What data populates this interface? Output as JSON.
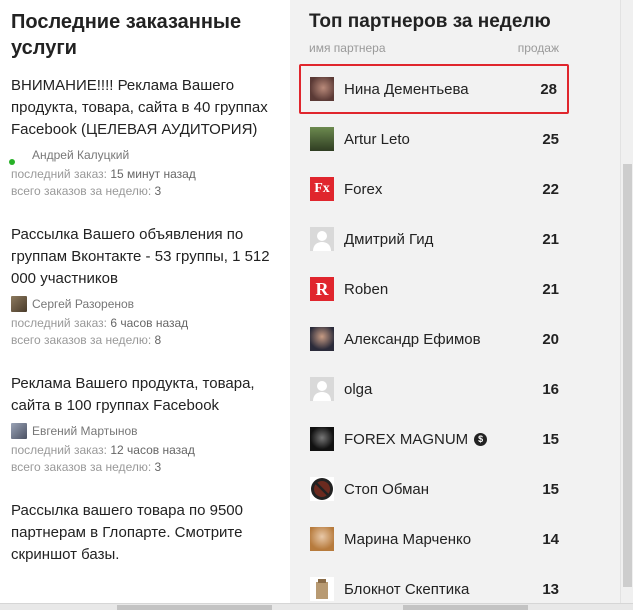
{
  "left": {
    "title": "Последние заказанные услуги",
    "orders": [
      {
        "title": "ВНИМАНИЕ!!!! Реклама Вашего продукта, товара, сайта в 40 группах Facebook (ЦЕЛЕВАЯ АУДИТОРИЯ)",
        "user": "Андрей Калуцкий",
        "last_label": "последний заказ:",
        "last_value": "15 минут назад",
        "week_label": "всего заказов за неделю:",
        "week_value": "3"
      },
      {
        "title": "Рассылка Вашего объявления по группам Вконтакте - 53 группы, 1 512 000 участников",
        "user": "Сергей Разоренов",
        "last_label": "последний заказ:",
        "last_value": "6 часов назад",
        "week_label": "всего заказов за неделю:",
        "week_value": "8"
      },
      {
        "title": "Реклама Вашего продукта, товара, сайта в 100 группах Facebook",
        "user": "Евгений Мартынов",
        "last_label": "последний заказ:",
        "last_value": "12 часов назад",
        "week_label": "всего заказов за неделю:",
        "week_value": "3"
      },
      {
        "title": "Рассылка вашего товара по 9500 партнерам в Глопарте. Смотрите скриншот базы."
      }
    ]
  },
  "right": {
    "title": "Топ партнеров за неделю",
    "col_name": "имя партнера",
    "col_sales": "продаж",
    "partners": [
      {
        "name": "Нина Дементьева",
        "sales": "28",
        "highlight": true
      },
      {
        "name": "Artur Leto",
        "sales": "25"
      },
      {
        "name": "Forex",
        "sales": "22",
        "avatar_text": "Fx"
      },
      {
        "name": "Дмитрий Гид",
        "sales": "21"
      },
      {
        "name": "Roben",
        "sales": "21",
        "avatar_text": "R"
      },
      {
        "name": "Александр Ефимов",
        "sales": "20"
      },
      {
        "name": "olga",
        "sales": "16"
      },
      {
        "name": "FOREX MAGNUM",
        "sales": "15",
        "badge": "$"
      },
      {
        "name": "Стоп Обман",
        "sales": "15"
      },
      {
        "name": "Марина Марченко",
        "sales": "14"
      },
      {
        "name": "Блокнот Скептика",
        "sales": "13"
      }
    ]
  },
  "colors": {
    "highlight_border": "#e0262d",
    "right_bg": "#f2f2f2",
    "online": "#27b127"
  }
}
